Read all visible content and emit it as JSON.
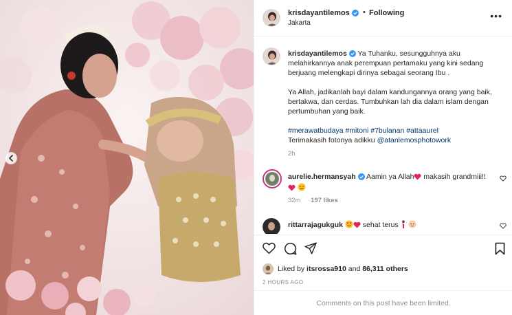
{
  "post": {
    "username": "krisdayantilemos",
    "follow_label": "Following",
    "location": "Jakarta",
    "caption": {
      "username": "krisdayantilemos",
      "paragraph1": "Ya Tuhanku, sesungguhnya aku melahirkannya anak perempuan pertamaku yang kini sedang berjuang melengkapi dirinya sebagai seorang Ibu .",
      "paragraph2": "Ya Allah, jadikanlah bayi dalam kandungannya orang yang baik, bertakwa, dan cerdas. Tumbuhkan lah dia dalam islam dengan pertumbuhan yang baik.",
      "hashtags": "#merawatbudaya #mitoni #7bulanan #attaaurel",
      "thanks_text": "Terimakasih fotonya adikku",
      "thanks_mention": "@atanlemosphotowork",
      "time": "2h"
    },
    "comments": [
      {
        "username": "aurelie.hermansyah",
        "text_before": "Aamin ya Allah",
        "text_after": "makasih grandmiii!!",
        "time": "32m",
        "likes": "197 likes"
      },
      {
        "username": "rittarrajagukguk",
        "text": "sehat terus"
      }
    ],
    "liked_by_prefix": "Liked by",
    "liked_by_user": "itsrossa910",
    "liked_by_and": "and",
    "liked_by_others": "86,311 others",
    "time_ago": "2 HOURS AGO",
    "comments_limited": "Comments on this post have been limited."
  },
  "icons": {
    "verified": "verified-badge-icon",
    "more": "more-options-icon",
    "heart": "heart-icon",
    "comment": "comment-icon",
    "share": "share-icon",
    "save": "bookmark-icon",
    "prev": "chevron-left-icon"
  },
  "colors": {
    "verified_blue": "#3897f0",
    "link_blue": "#00376b",
    "muted_gray": "#8e8e8e",
    "emoji_red": "#e0245e"
  }
}
